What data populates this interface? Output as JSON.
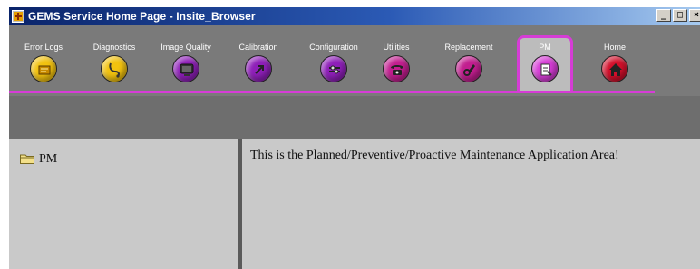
{
  "window": {
    "title": "GEMS Service Home Page - Insite_Browser",
    "minimize": "_",
    "maximize": "□",
    "close": "×"
  },
  "toolbar": {
    "items": [
      {
        "label": "Error Logs",
        "color": "#f2c20f",
        "icon": "log-icon"
      },
      {
        "label": "Diagnostics",
        "color": "#f2c20f",
        "icon": "stethoscope-icon"
      },
      {
        "label": "Image Quality",
        "color": "#8e1fb8",
        "icon": "monitor-icon"
      },
      {
        "label": "Calibration",
        "color": "#8e1fb8",
        "icon": "calibration-icon"
      },
      {
        "label": "Configuration",
        "color": "#8e1fb8",
        "icon": "configuration-icon"
      },
      {
        "label": "Utilities",
        "color": "#c21e8f",
        "icon": "phone-icon"
      },
      {
        "label": "Replacement",
        "color": "#c21e8f",
        "icon": "replacement-icon"
      },
      {
        "label": "PM",
        "color": "#d63cd6",
        "icon": "clipboard-icon",
        "selected": true
      },
      {
        "label": "Home",
        "color": "#d10f2a",
        "icon": "home-icon"
      }
    ],
    "accent": "#d63cd6"
  },
  "tree": {
    "items": [
      {
        "label": "PM",
        "icon": "folder-icon"
      }
    ]
  },
  "content": {
    "message": "This is the Planned/Preventive/Proactive Maintenance Application Area!"
  }
}
